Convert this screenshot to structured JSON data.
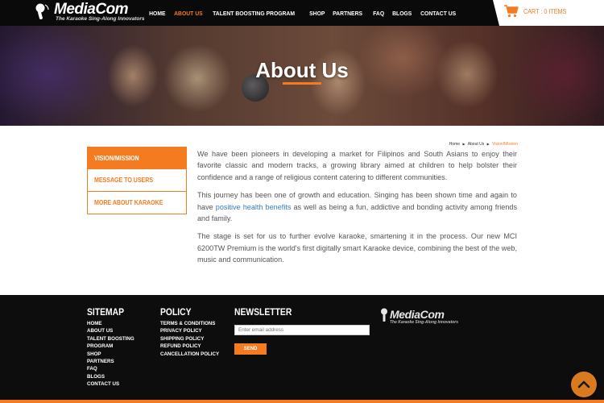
{
  "header": {
    "logo_name": "MediaCom",
    "logo_tagline": "The Karaoke Sing-Along Innovators",
    "logo_icon": "microphone-icon",
    "nav": [
      {
        "label": "HOME",
        "active": false
      },
      {
        "label": "ABOUT US",
        "active": true
      },
      {
        "label": "TALENT BOOSTING PROGRAM",
        "active": false
      },
      {
        "label": "SHOP",
        "active": false
      },
      {
        "label": "PARTNERS",
        "active": false
      },
      {
        "label": "FAQ",
        "active": false
      },
      {
        "label": "BLOGS",
        "active": false
      },
      {
        "label": "CONTACT US",
        "active": false
      }
    ],
    "cart_label": "CART : 0 ITEMS",
    "cart_icon": "cart-icon"
  },
  "hero": {
    "title": "About Us"
  },
  "breadcrumb": {
    "items": [
      "Home",
      "About Us"
    ],
    "current": "Vision/Mission"
  },
  "side_menu": {
    "items": [
      {
        "label": "VISION/MISSION",
        "active": true
      },
      {
        "label": "MESSAGE TO USERS",
        "active": false
      },
      {
        "label": "MORE ABOUT KARAOKE",
        "active": false
      }
    ]
  },
  "content": {
    "p1": "We have been pioneers in developing a market for Filipinos and South Asians to enjoy their favorite classic and modern tracks, a growing library aimed at children to help bolster their confidence and a range of religious content catering to different communities.",
    "p2_before": "This journey has been one of growth and education. Singing has been shown time and again to have ",
    "p2_link": "positive health benefits",
    "p2_after": " as well as being a fun, addictive and bonding activity among friends and family.",
    "p3": "The stage is set for us to further evolve karaoke, smartening it in the process. Our new MCI 6200TW Premium is the world's first digitally smart Karaoke device, combining the best of the web, music and communication."
  },
  "footer": {
    "sitemap_title": "SITEMAP",
    "sitemap_links": [
      "HOME",
      "ABOUT US",
      "TALENT BOOSTING",
      "PROGRAM",
      "SHOP",
      "PARTNERS",
      "FAQ",
      "BLOGS",
      "CONTACT US"
    ],
    "policy_title": "POLICY",
    "policy_links": [
      "TERMS & CONDITIONS",
      "PRIVACY POLICY",
      "SHIPPING POLICY",
      "REFUND POLICY",
      "CANCELLATION POLICY"
    ],
    "newsletter_title": "NEWSLETTER",
    "newsletter_placeholder": "Enter email address",
    "newsletter_button": "SEND",
    "logo_name": "MediaCom",
    "logo_tagline": "The Karaoke Sing-Along Innovators"
  },
  "scroll_top_icon": "chevron-up-icon",
  "colors": {
    "accent": "#f47b20",
    "header_bg": "#0a0a0a",
    "footer_bg": "#0d0d0d",
    "link": "#3a7bc8"
  }
}
